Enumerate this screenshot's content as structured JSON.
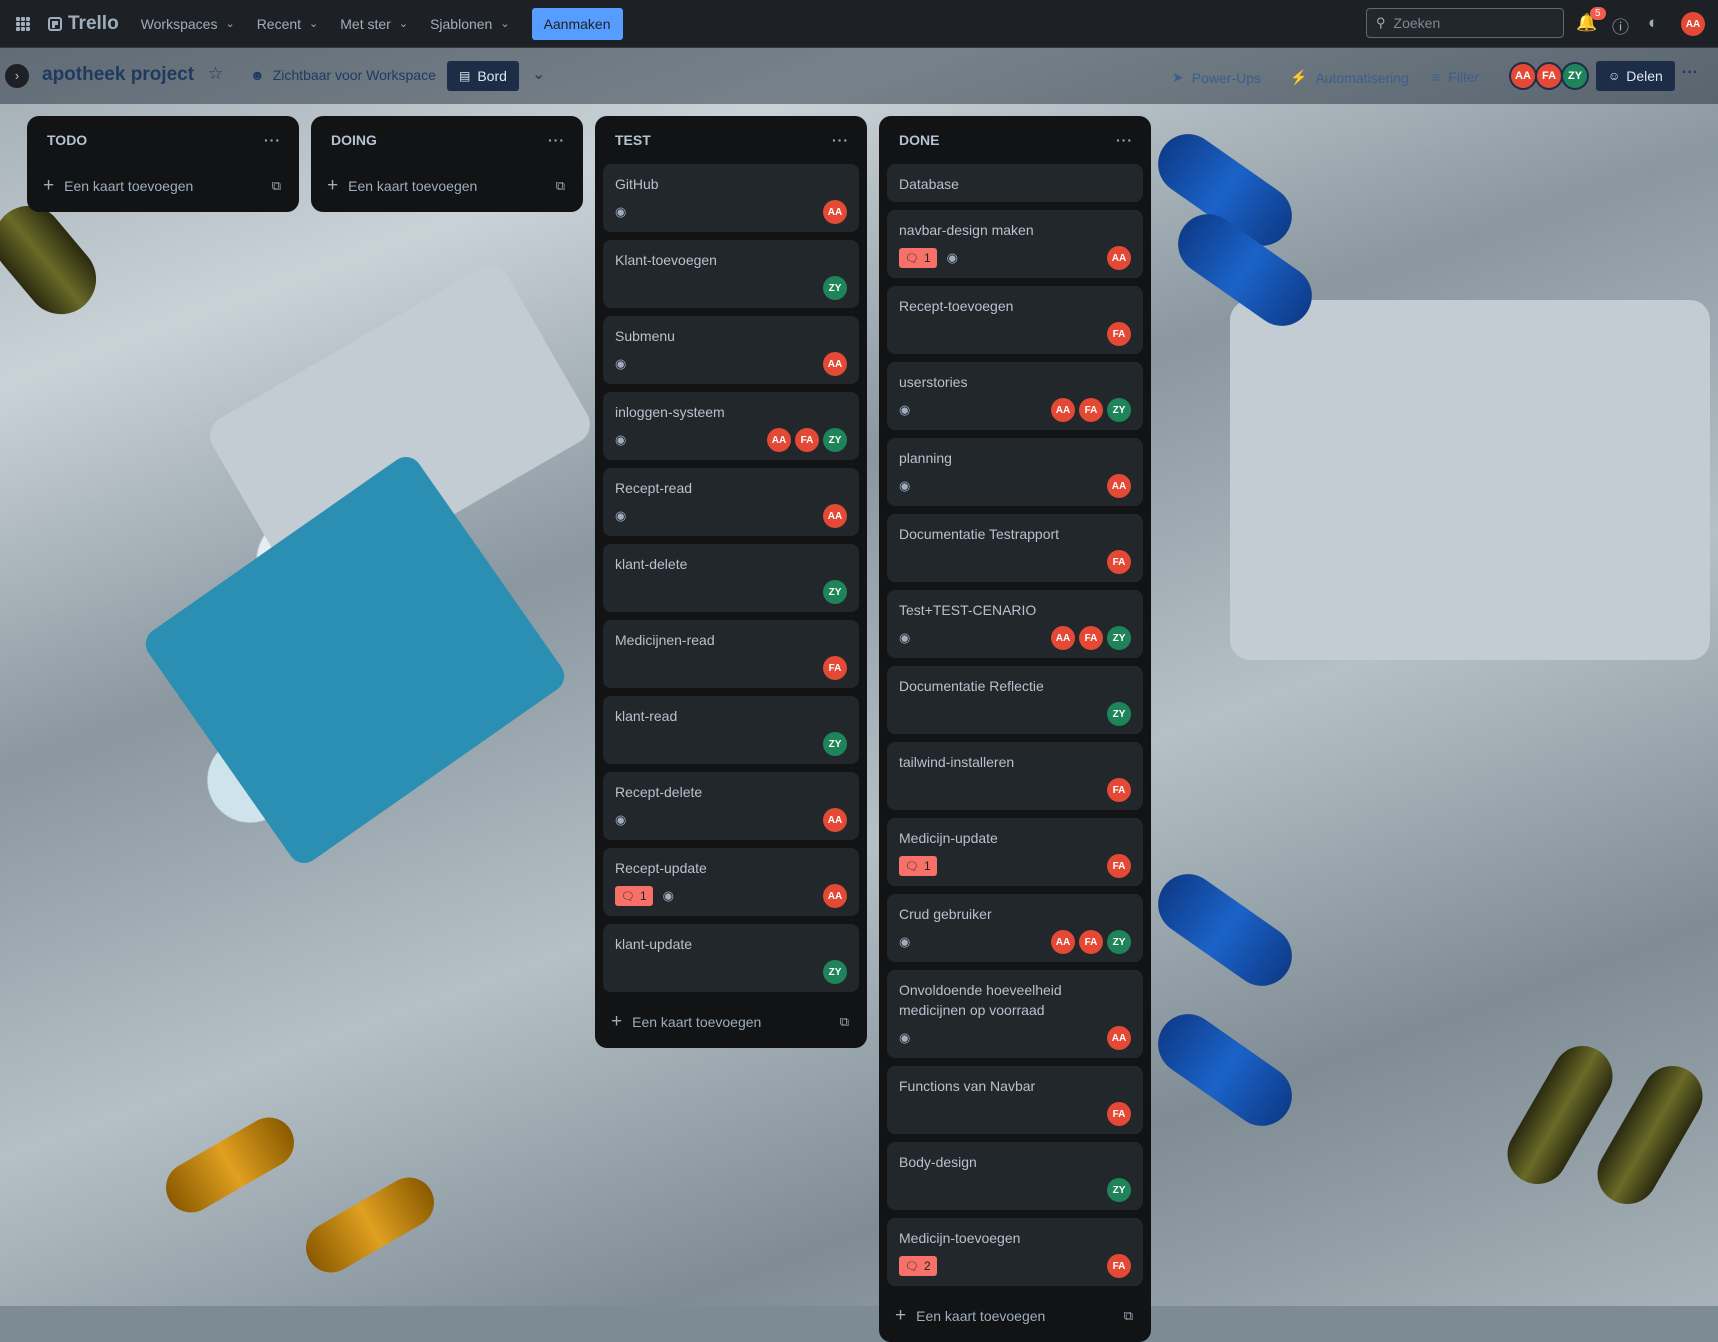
{
  "colors": {
    "topbar": "#1d2125",
    "list_bg": "#111315",
    "card_bg": "#22272b",
    "primary_button": "#579dff",
    "avatar_red": "#e34935",
    "avatar_green": "#1f845a",
    "comment_badge": "#f87168"
  },
  "topbar": {
    "apps_icon": "grid-icon",
    "logo": "Trello",
    "nav": [
      "Workspaces",
      "Recent",
      "Met ster",
      "Sjablonen"
    ],
    "create_label": "Aanmaken",
    "search_placeholder": "Zoeken",
    "notification_count": "5",
    "user_initials": "AA"
  },
  "board": {
    "title": "apotheek project",
    "visibility": "Zichtbaar voor Workspace",
    "view_label": "Bord",
    "power_ups": "Power-Ups",
    "automation": "Automatisering",
    "filter": "Filter",
    "members": [
      "AA",
      "FA",
      "ZY"
    ],
    "share_label": "Delen"
  },
  "lists": [
    {
      "title": "TODO",
      "add_label": "Een kaart toevoegen",
      "cards": []
    },
    {
      "title": "DOING",
      "add_label": "Een kaart toevoegen",
      "cards": []
    },
    {
      "title": "TEST",
      "add_label": "Een kaart toevoegen",
      "cards": [
        {
          "title": "GitHub",
          "watch": true,
          "comments": null,
          "members": [
            "AA"
          ]
        },
        {
          "title": "Klant-toevoegen",
          "watch": false,
          "comments": null,
          "members": [
            "ZY"
          ]
        },
        {
          "title": "Submenu",
          "watch": true,
          "comments": null,
          "members": [
            "AA"
          ]
        },
        {
          "title": "inloggen-systeem",
          "watch": true,
          "comments": null,
          "members": [
            "AA",
            "FA",
            "ZY"
          ]
        },
        {
          "title": "Recept-read",
          "watch": true,
          "comments": null,
          "members": [
            "AA"
          ]
        },
        {
          "title": "klant-delete",
          "watch": false,
          "comments": null,
          "members": [
            "ZY"
          ]
        },
        {
          "title": "Medicijnen-read",
          "watch": false,
          "comments": null,
          "members": [
            "FA"
          ]
        },
        {
          "title": "klant-read",
          "watch": false,
          "comments": null,
          "members": [
            "ZY"
          ]
        },
        {
          "title": "Recept-delete",
          "watch": true,
          "comments": null,
          "members": [
            "AA"
          ]
        },
        {
          "title": "Recept-update",
          "watch": true,
          "comments": "1",
          "members": [
            "AA"
          ]
        },
        {
          "title": "klant-update",
          "watch": false,
          "comments": null,
          "members": [
            "ZY"
          ]
        }
      ]
    },
    {
      "title": "DONE",
      "add_label": "Een kaart toevoegen",
      "cards": [
        {
          "title": "Database",
          "watch": false,
          "comments": null,
          "members": []
        },
        {
          "title": "navbar-design maken",
          "watch": true,
          "comments": "1",
          "members": [
            "AA"
          ]
        },
        {
          "title": "Recept-toevoegen",
          "watch": false,
          "comments": null,
          "members": [
            "FA"
          ]
        },
        {
          "title": "userstories",
          "watch": true,
          "comments": null,
          "members": [
            "AA",
            "FA",
            "ZY"
          ]
        },
        {
          "title": "planning",
          "watch": true,
          "comments": null,
          "members": [
            "AA"
          ]
        },
        {
          "title": "Documentatie Testrapport",
          "watch": false,
          "comments": null,
          "members": [
            "FA"
          ]
        },
        {
          "title": "Test+TEST-CENARIO",
          "watch": true,
          "comments": null,
          "members": [
            "AA",
            "FA",
            "ZY"
          ]
        },
        {
          "title": "Documentatie Reflectie",
          "watch": false,
          "comments": null,
          "members": [
            "ZY"
          ]
        },
        {
          "title": "tailwind-installeren",
          "watch": false,
          "comments": null,
          "members": [
            "FA"
          ]
        },
        {
          "title": "Medicijn-update",
          "watch": false,
          "comments": "1",
          "members": [
            "FA"
          ]
        },
        {
          "title": "Crud gebruiker",
          "watch": true,
          "comments": null,
          "members": [
            "AA",
            "FA",
            "ZY"
          ]
        },
        {
          "title": "Onvoldoende hoeveelheid medicijnen op voorraad",
          "watch": true,
          "comments": null,
          "members": [
            "AA"
          ]
        },
        {
          "title": "Functions van Navbar",
          "watch": false,
          "comments": null,
          "members": [
            "FA"
          ]
        },
        {
          "title": "Body-design",
          "watch": false,
          "comments": null,
          "members": [
            "ZY"
          ]
        },
        {
          "title": "Medicijn-toevoegen",
          "watch": false,
          "comments": "2",
          "members": [
            "FA"
          ]
        }
      ]
    }
  ]
}
